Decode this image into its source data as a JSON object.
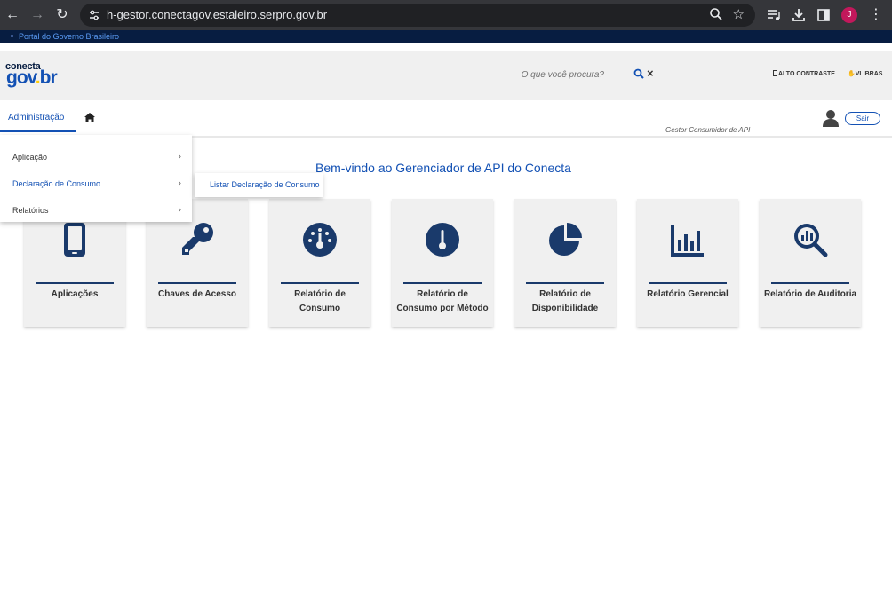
{
  "browser": {
    "url": "h-gestor.conectagov.estaleiro.serpro.gov.br",
    "profile_initial": "J"
  },
  "govbar": {
    "link": "Portal do Governo Brasileiro"
  },
  "header": {
    "logo_top": "conecta",
    "logo_gov": "gov",
    "logo_dot": ".",
    "logo_br": "br",
    "search_placeholder": "O que você procura?",
    "contrast": "ALTO CONTRASTE",
    "libras": "VLIBRAS"
  },
  "menu": {
    "admin": "Administração",
    "role": "Gestor Consumidor de API",
    "logout": "Sair"
  },
  "dropdown": {
    "items": [
      {
        "label": "Aplicação"
      },
      {
        "label": "Declaração de Consumo"
      },
      {
        "label": "Relatórios"
      }
    ],
    "submenu": "Listar Declaração de Consumo"
  },
  "welcome": "Bem-vindo ao Gerenciador de API do Conecta",
  "cards": [
    {
      "label": "Aplicações",
      "icon": "mobile-icon"
    },
    {
      "label": "Chaves de Acesso",
      "icon": "key-icon"
    },
    {
      "label": "Relatório de Consumo",
      "icon": "dashboard-icon"
    },
    {
      "label": "Relatório de Consumo por Método",
      "icon": "thermometer-icon"
    },
    {
      "label": "Relatório de Disponibilidade",
      "icon": "pie-chart-icon"
    },
    {
      "label": "Relatório Gerencial",
      "icon": "bar-chart-icon"
    },
    {
      "label": "Relatório de Auditoria",
      "icon": "search-chart-icon"
    }
  ],
  "colors": {
    "gov_blue": "#1351b4",
    "navy": "#071d41",
    "card_bg": "#f0f0f0"
  }
}
